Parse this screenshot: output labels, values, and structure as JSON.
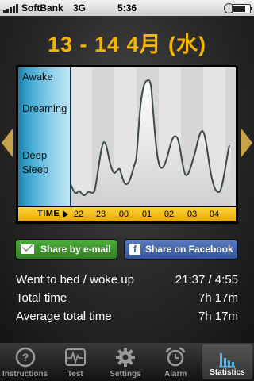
{
  "status_bar": {
    "carrier": "SoftBank",
    "network": "3G",
    "time": "5:36"
  },
  "header": {
    "title": "13 - 14 4月 (水)"
  },
  "graph": {
    "y_labels": [
      "Awake",
      "Dreaming",
      "Deep",
      "Sleep"
    ],
    "time_label": "TIME",
    "hours": [
      "22",
      "23",
      "00",
      "01",
      "02",
      "03",
      "04"
    ],
    "sleep_curve_colors": {
      "line": "#3a4a4a",
      "fill": "#ffffff",
      "shade": "#c9c9c9"
    }
  },
  "share": {
    "email_label": "Share by e-mail",
    "facebook_label": "Share on Facebook"
  },
  "stats": [
    {
      "label": "Went to bed / woke up",
      "value": "21:37 / 4:55"
    },
    {
      "label": "Total time",
      "value": "7h 17m"
    },
    {
      "label": "Average total time",
      "value": "7h 17m"
    }
  ],
  "tabs": [
    {
      "label": "Instructions",
      "icon": "question-icon",
      "active": false
    },
    {
      "label": "Test",
      "icon": "pulse-icon",
      "active": false
    },
    {
      "label": "Settings",
      "icon": "gear-icon",
      "active": false
    },
    {
      "label": "Alarm",
      "icon": "alarm-clock-icon",
      "active": false
    },
    {
      "label": "Statistics",
      "icon": "bar-chart-icon",
      "active": true
    }
  ]
}
